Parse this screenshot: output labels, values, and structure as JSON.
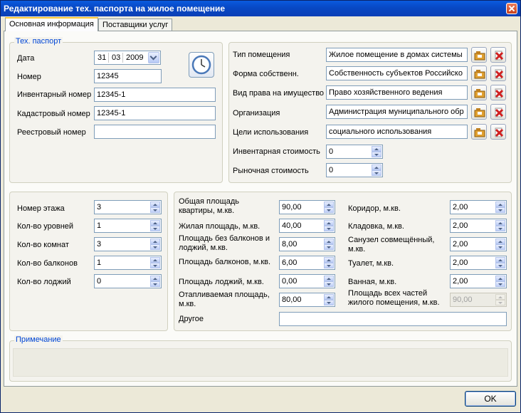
{
  "window": {
    "title": "Редактирование тех. паспорта на жилое помещение"
  },
  "tabs": [
    {
      "label": "Основная информация",
      "active": true
    },
    {
      "label": "Поставщики услуг",
      "active": false
    }
  ],
  "passport": {
    "group_title": "Тех. паспорт",
    "date_label": "Дата",
    "date": {
      "day": "31",
      "month": "03",
      "year": "2009"
    },
    "number_label": "Номер",
    "number": "12345",
    "inventory_label": "Инвентарный номер",
    "inventory": "12345-1",
    "cadastral_label": "Кадастровый номер",
    "cadastral": "12345-1",
    "registry_label": "Реестровый номер",
    "registry": ""
  },
  "property": {
    "type_label": "Тип помещения",
    "type": "Жилое помещение в домах системы",
    "ownership_label": "Форма собственн.",
    "ownership": "Собственность субъектов Российско",
    "right_label": "Вид права на имущество",
    "right": "Право хозяйственного ведения",
    "org_label": "Организация",
    "org": "Администрация муниципального обр",
    "purpose_label": "Цели использования",
    "purpose": "социального использования",
    "inv_cost_label": "Инвентарная стоимость",
    "inv_cost": "0",
    "market_cost_label": "Рыночная стоимость",
    "market_cost": "0"
  },
  "floor": {
    "floor_label": "Номер этажа",
    "floor": "3",
    "levels_label": "Кол-во уровней",
    "levels": "1",
    "rooms_label": "Кол-во комнат",
    "rooms": "3",
    "balconies_label": "Кол-во балконов",
    "balconies": "1",
    "loggias_label": "Кол-во лоджий",
    "loggias": "0"
  },
  "areas": {
    "total_label": "Общая площадь квартиры, м.кв.",
    "total": "90,00",
    "living_label": "Жилая площадь, м.кв.",
    "living": "40,00",
    "no_balcony_label": "Площадь без балконов и лоджий, м.кв.",
    "no_balcony": "8,00",
    "balcony_label": "Площадь балконов, м.кв.",
    "balcony": "6,00",
    "loggia_label": "Площадь лоджий, м.кв.",
    "loggia": "0,00",
    "heated_label": "Отапливаемая площадь, м.кв.",
    "heated": "80,00",
    "other_label": "Другое",
    "other": "",
    "corridor_label": "Коридор, м.кв.",
    "corridor": "2,00",
    "storage_label": "Кладовка, м.кв.",
    "storage": "2,00",
    "combined_bath_label": "Санузел совмещённый, м.кв.",
    "combined_bath": "2,00",
    "toilet_label": "Туалет, м.кв.",
    "toilet": "2,00",
    "bathroom_label": "Ванная, м.кв.",
    "bathroom": "2,00",
    "all_parts_label": "Площадь всех частей жилого помещения, м.кв.",
    "all_parts": "90,00"
  },
  "note": {
    "title": "Примечание",
    "value": ""
  },
  "footer": {
    "ok_label": "OK"
  }
}
